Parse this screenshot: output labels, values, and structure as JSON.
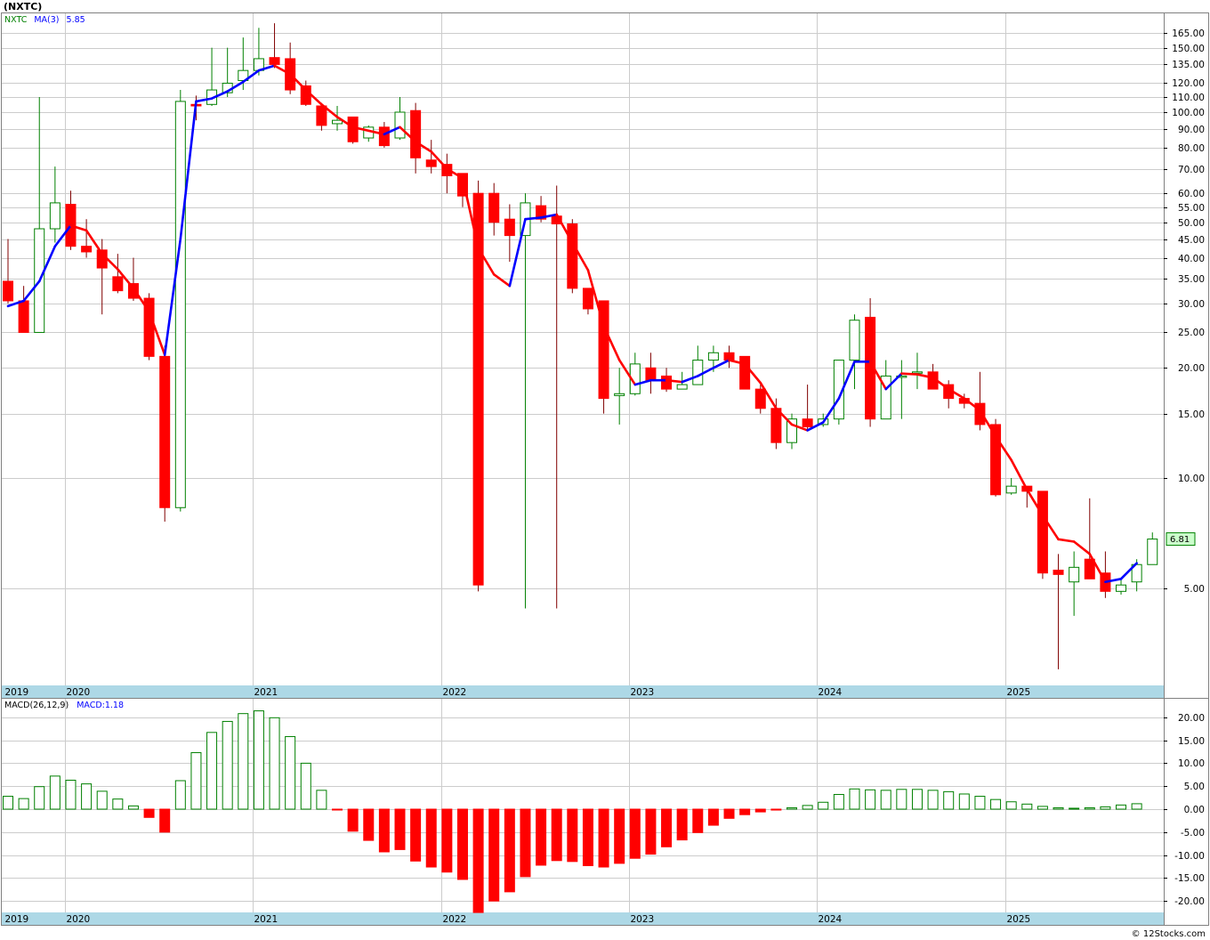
{
  "header": {
    "title": "(NXTC)"
  },
  "footer": {
    "credit": "© 12Stocks.com"
  },
  "colors": {
    "up": "#008000",
    "down": "#ff0000",
    "ma_up": "#0000ff",
    "ma_down": "#ff0000",
    "axis_band": "#add8e6",
    "grid": "#cccccc",
    "last_price_tag": "#ccffcc"
  },
  "chart_data": [
    {
      "type": "candlestick",
      "title": "(NXTC)",
      "legend": {
        "symbol": "NXTC",
        "indicator": "MA(3)",
        "value": "5.85"
      },
      "y_scale": "log",
      "ylim": [
        3.0,
        175
      ],
      "y_ticks": [
        "165.00",
        "150.00",
        "135.00",
        "120.00",
        "110.00",
        "100.00",
        "90.00",
        "80.00",
        "70.00",
        "60.00",
        "55.00",
        "50.00",
        "45.00",
        "40.00",
        "35.00",
        "30.00",
        "25.00",
        "20.00",
        "15.00",
        "10.00",
        "5.00"
      ],
      "x_labels": [
        "2019",
        "2020",
        "2021",
        "2022",
        "2023",
        "2024",
        "2025"
      ],
      "last_price_label": "6.81",
      "grid": true,
      "bars": [
        {
          "date": "2019-09",
          "open": 34.5,
          "high": 45,
          "low": 30,
          "close": 30.5
        },
        {
          "date": "2019-10",
          "open": 30.5,
          "high": 33.5,
          "low": 25,
          "close": 25
        },
        {
          "date": "2019-11",
          "open": 25,
          "high": 110,
          "low": 25,
          "close": 48
        },
        {
          "date": "2019-12",
          "open": 48,
          "high": 71,
          "low": 44,
          "close": 56.5
        },
        {
          "date": "2020-01",
          "open": 56,
          "high": 61,
          "low": 42,
          "close": 43
        },
        {
          "date": "2020-02",
          "open": 43,
          "high": 51,
          "low": 40,
          "close": 41.5
        },
        {
          "date": "2020-03",
          "open": 42,
          "high": 45,
          "low": 28,
          "close": 37.5
        },
        {
          "date": "2020-04",
          "open": 35.5,
          "high": 41,
          "low": 32,
          "close": 32.5
        },
        {
          "date": "2020-05",
          "open": 34,
          "high": 40,
          "low": 30.5,
          "close": 31
        },
        {
          "date": "2020-06",
          "open": 31,
          "high": 32,
          "low": 21,
          "close": 21.5
        },
        {
          "date": "2020-07",
          "open": 21.5,
          "high": 23,
          "low": 7.6,
          "close": 8.3
        },
        {
          "date": "2020-08",
          "open": 8.3,
          "high": 115,
          "low": 8.1,
          "close": 107
        },
        {
          "date": "2020-09",
          "open": 105,
          "high": 111,
          "low": 95,
          "close": 104
        },
        {
          "date": "2020-10",
          "open": 105,
          "high": 150,
          "low": 104,
          "close": 115
        },
        {
          "date": "2020-11",
          "open": 113,
          "high": 150,
          "low": 110,
          "close": 120
        },
        {
          "date": "2020-12",
          "open": 122,
          "high": 160,
          "low": 115,
          "close": 130
        },
        {
          "date": "2021-01",
          "open": 130,
          "high": 170,
          "low": 126,
          "close": 140
        },
        {
          "date": "2021-02",
          "open": 141,
          "high": 175,
          "low": 132,
          "close": 135
        },
        {
          "date": "2021-03",
          "open": 140,
          "high": 155,
          "low": 112,
          "close": 115
        },
        {
          "date": "2021-04",
          "open": 118,
          "high": 122,
          "low": 104,
          "close": 105
        },
        {
          "date": "2021-05",
          "open": 104,
          "high": 106,
          "low": 89,
          "close": 92
        },
        {
          "date": "2021-06",
          "open": 93,
          "high": 104,
          "low": 89,
          "close": 95
        },
        {
          "date": "2021-07",
          "open": 97,
          "high": 97,
          "low": 82,
          "close": 83
        },
        {
          "date": "2021-08",
          "open": 85,
          "high": 92,
          "low": 83,
          "close": 91
        },
        {
          "date": "2021-09",
          "open": 91,
          "high": 94,
          "low": 80,
          "close": 81
        },
        {
          "date": "2021-10",
          "open": 85,
          "high": 110,
          "low": 84,
          "close": 100
        },
        {
          "date": "2021-11",
          "open": 101,
          "high": 106,
          "low": 68,
          "close": 75
        },
        {
          "date": "2021-12",
          "open": 74,
          "high": 84,
          "low": 68,
          "close": 71
        },
        {
          "date": "2022-01",
          "open": 72,
          "high": 77,
          "low": 60,
          "close": 67
        },
        {
          "date": "2022-02",
          "open": 68,
          "high": 68,
          "low": 55,
          "close": 59
        },
        {
          "date": "2022-03",
          "open": 60,
          "high": 65,
          "low": 4.9,
          "close": 5.1
        },
        {
          "date": "2022-04",
          "open": 60,
          "high": 64,
          "low": 46,
          "close": 50
        },
        {
          "date": "2022-05",
          "open": 51,
          "high": 56,
          "low": 39,
          "close": 46
        },
        {
          "date": "2022-06",
          "open": 46,
          "high": 60,
          "low": 4.4,
          "close": 56.5
        },
        {
          "date": "2022-07",
          "open": 55.5,
          "high": 59,
          "low": 50,
          "close": 51
        },
        {
          "date": "2022-08",
          "open": 52,
          "high": 63,
          "low": 4.4,
          "close": 49.5
        },
        {
          "date": "2022-09",
          "open": 49.5,
          "high": 51,
          "low": 32,
          "close": 33
        },
        {
          "date": "2022-10",
          "open": 33,
          "high": 33,
          "low": 28,
          "close": 29
        },
        {
          "date": "2022-11",
          "open": 30.5,
          "high": 30.5,
          "low": 15,
          "close": 16.5
        },
        {
          "date": "2022-12",
          "open": 16.8,
          "high": 20,
          "low": 14,
          "close": 17
        },
        {
          "date": "2023-01",
          "open": 17,
          "high": 22,
          "low": 16.8,
          "close": 20.5
        },
        {
          "date": "2023-02",
          "open": 20,
          "high": 22,
          "low": 17,
          "close": 18.5
        },
        {
          "date": "2023-03",
          "open": 19,
          "high": 20,
          "low": 17.2,
          "close": 17.5
        },
        {
          "date": "2023-04",
          "open": 17.5,
          "high": 19.5,
          "low": 17.5,
          "close": 18
        },
        {
          "date": "2023-05",
          "open": 18,
          "high": 23,
          "low": 18,
          "close": 21
        },
        {
          "date": "2023-06",
          "open": 21,
          "high": 23,
          "low": 19.5,
          "close": 22
        },
        {
          "date": "2023-07",
          "open": 22,
          "high": 23,
          "low": 20,
          "close": 21
        },
        {
          "date": "2023-08",
          "open": 21.5,
          "high": 21.5,
          "low": 17.5,
          "close": 17.5
        },
        {
          "date": "2023-09",
          "open": 17.5,
          "high": 18,
          "low": 15,
          "close": 15.5
        },
        {
          "date": "2023-10",
          "open": 15.5,
          "high": 16.5,
          "low": 12,
          "close": 12.5
        },
        {
          "date": "2023-11",
          "open": 12.5,
          "high": 15,
          "low": 12,
          "close": 14.5
        },
        {
          "date": "2023-12",
          "open": 14.5,
          "high": 18,
          "low": 13.5,
          "close": 13.8
        },
        {
          "date": "2024-01",
          "open": 14,
          "high": 15,
          "low": 13.8,
          "close": 14.5
        },
        {
          "date": "2024-02",
          "open": 14.5,
          "high": 21,
          "low": 14,
          "close": 21
        },
        {
          "date": "2024-03",
          "open": 21,
          "high": 28,
          "low": 17.5,
          "close": 27
        },
        {
          "date": "2024-04",
          "open": 27.5,
          "high": 31,
          "low": 13.8,
          "close": 14.5
        },
        {
          "date": "2024-05",
          "open": 14.5,
          "high": 21,
          "low": 14.5,
          "close": 19
        },
        {
          "date": "2024-06",
          "open": 19,
          "high": 21,
          "low": 14.5,
          "close": 19
        },
        {
          "date": "2024-07",
          "open": 19.5,
          "high": 22,
          "low": 17.5,
          "close": 19.5
        },
        {
          "date": "2024-08",
          "open": 19.5,
          "high": 20.5,
          "low": 17.5,
          "close": 17.5
        },
        {
          "date": "2024-09",
          "open": 18,
          "high": 18.5,
          "low": 15.5,
          "close": 16.5
        },
        {
          "date": "2024-10",
          "open": 16.5,
          "high": 17,
          "low": 15.5,
          "close": 16
        },
        {
          "date": "2024-11",
          "open": 16,
          "high": 19.5,
          "low": 13.5,
          "close": 14
        },
        {
          "date": "2024-12",
          "open": 14,
          "high": 14.5,
          "low": 8.9,
          "close": 9
        },
        {
          "date": "2025-01",
          "open": 9.1,
          "high": 10,
          "low": 9,
          "close": 9.5
        },
        {
          "date": "2025-02",
          "open": 9.5,
          "high": 9.5,
          "low": 8.3,
          "close": 9.2
        },
        {
          "date": "2025-03",
          "open": 9.2,
          "high": 9.2,
          "low": 5.3,
          "close": 5.5
        },
        {
          "date": "2025-04",
          "open": 5.6,
          "high": 6.2,
          "low": 3.0,
          "close": 5.45
        },
        {
          "date": "2025-05",
          "open": 5.2,
          "high": 6.3,
          "low": 4.2,
          "close": 5.7
        },
        {
          "date": "2025-06",
          "open": 6.0,
          "high": 8.8,
          "low": 5.3,
          "close": 5.3
        },
        {
          "date": "2025-07",
          "open": 5.5,
          "high": 6.3,
          "low": 4.7,
          "close": 4.9
        },
        {
          "date": "2025-08",
          "open": 4.9,
          "high": 5.3,
          "low": 4.8,
          "close": 5.1
        },
        {
          "date": "2025-09",
          "open": 5.2,
          "high": 6.0,
          "low": 4.9,
          "close": 5.8
        },
        {
          "date": "2025-10",
          "open": 5.8,
          "high": 7.1,
          "low": 5.8,
          "close": 6.81
        }
      ],
      "ma": [
        29.5,
        30.5,
        34.5,
        43,
        49,
        47.5,
        41,
        37.2,
        33,
        28.5,
        21.7,
        45,
        107,
        109,
        114,
        121,
        130,
        134,
        127,
        115,
        105,
        97,
        91,
        89,
        87,
        91,
        83,
        78,
        70,
        66,
        42.5,
        36,
        33.5,
        51,
        51.5,
        52.5,
        44,
        37,
        26,
        21,
        18,
        18.5,
        18.5,
        18.3,
        19,
        20,
        21,
        20.5,
        18.2,
        15.5,
        14,
        13.5,
        14.2,
        16.5,
        20.8,
        20.8,
        17.5,
        19.3,
        19.2,
        18.8,
        17.5,
        16.5,
        15.3,
        13,
        11.2,
        9.3,
        7.9,
        6.8,
        6.7,
        6.2,
        5.2,
        5.3,
        5.85
      ]
    },
    {
      "type": "bar",
      "title": "MACD(26,12,9)",
      "legend": {
        "indicator": "MACD(26,12,9)",
        "value_label": "MACD:1.18"
      },
      "ylim": [
        -22,
        22
      ],
      "y_ticks": [
        "20.00",
        "15.00",
        "10.00",
        "5.00",
        "0.00",
        "-5.00",
        "-10.00",
        "-15.00",
        "-20.00"
      ],
      "x_labels": [
        "2019",
        "2020",
        "2021",
        "2022",
        "2023",
        "2024",
        "2025"
      ],
      "grid": true,
      "values": [
        2.8,
        2.3,
        4.9,
        7.2,
        6.3,
        5.5,
        3.9,
        2.2,
        0.7,
        -1.8,
        -5.0,
        6.2,
        12.3,
        16.7,
        19.1,
        20.8,
        21.4,
        19.9,
        15.8,
        10.0,
        4.1,
        -0.1,
        -4.8,
        -6.8,
        -9.3,
        -8.8,
        -11.3,
        -12.6,
        -13.7,
        -15.3,
        -22.5,
        -20.0,
        -18.0,
        -14.7,
        -12.2,
        -11.2,
        -11.4,
        -12.3,
        -12.6,
        -11.8,
        -10.7,
        -9.8,
        -8.2,
        -6.7,
        -5.1,
        -3.5,
        -2.0,
        -1.2,
        -0.6,
        -0.2,
        0.3,
        0.8,
        1.5,
        3.2,
        4.4,
        4.2,
        4.1,
        4.3,
        4.3,
        4.1,
        3.8,
        3.3,
        2.8,
        2.1,
        1.6,
        1.1,
        0.6,
        0.3,
        0.2,
        0.3,
        0.5,
        0.9,
        1.18
      ]
    }
  ]
}
